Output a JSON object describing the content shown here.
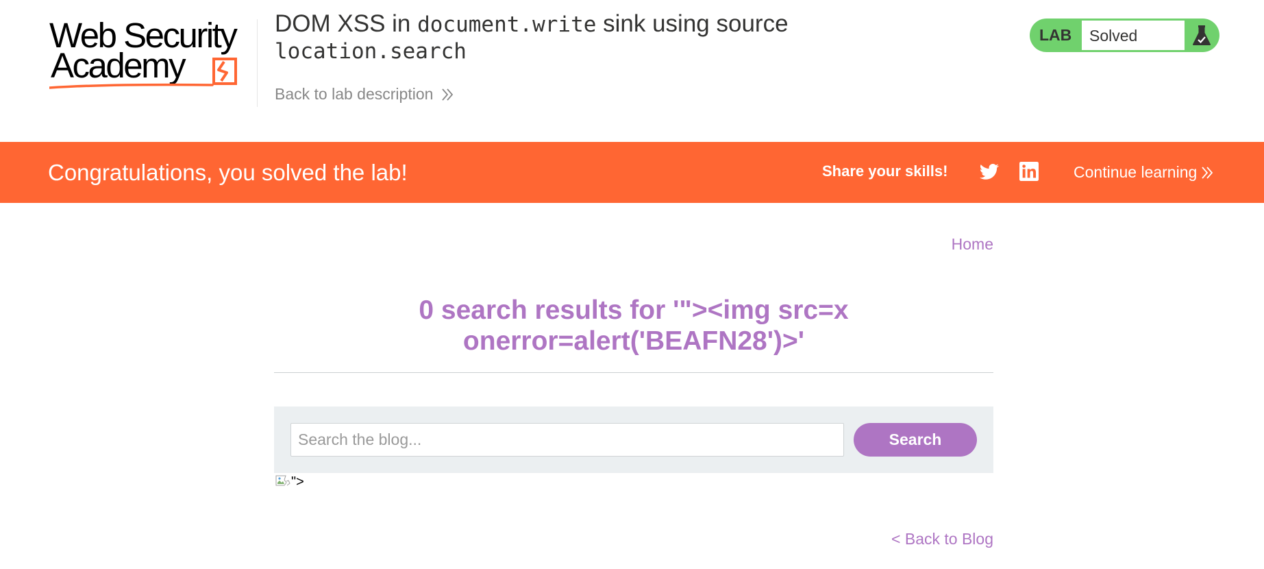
{
  "header": {
    "logo_line1": "Web Security",
    "logo_line2": "Academy",
    "title_prefix": "DOM XSS in ",
    "title_code1": "document.write",
    "title_middle": " sink using source",
    "title_code2": "location.search",
    "back_to_description": "Back to lab description",
    "status": {
      "lab_label": "LAB",
      "status_text": "Solved",
      "icon": "flask-icon"
    }
  },
  "banner": {
    "message": "Congratulations, you solved the lab!",
    "share_label": "Share your skills!",
    "twitter_icon": "twitter-icon",
    "linkedin_icon": "linkedin-icon",
    "continue_label": "Continue learning"
  },
  "page": {
    "home_link": "Home",
    "search_heading_line1": "0 search results for '\"><img src=x",
    "search_heading_line2": "onerror=alert('BEAFN28')>'",
    "search": {
      "placeholder": "Search the blog...",
      "button_label": "Search"
    },
    "injected_text": "\">",
    "back_to_blog": "< Back to Blog"
  },
  "colors": {
    "brand_orange": "#ff6633",
    "lab_green": "#70d16d",
    "accent_purple": "#ae75c3",
    "panel_grey": "#ebeff1"
  }
}
